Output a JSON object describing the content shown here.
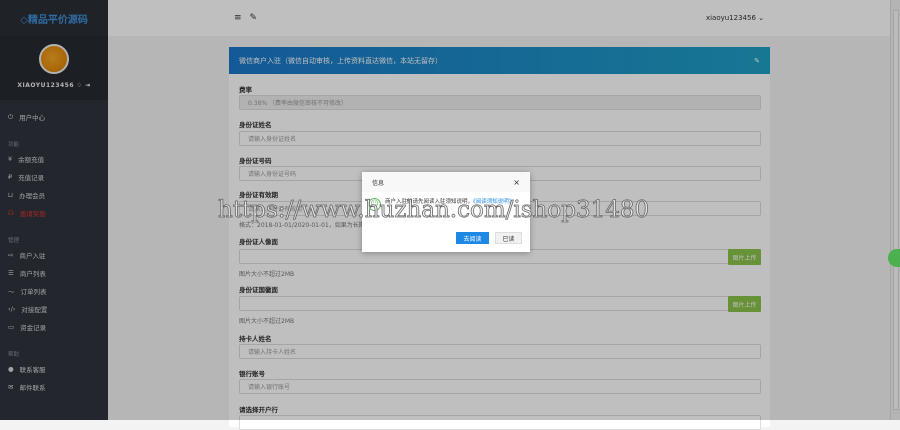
{
  "sidebar": {
    "logo": "◇精品平价源码",
    "username": "XIAOYU123456",
    "user_center": "用户中心",
    "groups": [
      {
        "title": "功能",
        "items": [
          "余额充值",
          "充值记录",
          "办理会员",
          "邀请奖励"
        ]
      },
      {
        "title": "管理",
        "items": [
          "商户入驻",
          "商户列表",
          "订单列表",
          "对接配置",
          "资金记录"
        ]
      },
      {
        "title": "帮助",
        "items": [
          "联系客服",
          "邮件联系"
        ]
      }
    ]
  },
  "topbar": {
    "menu_icon": "≡",
    "tool_icon": "✎",
    "user": "xiaoyu123456 ⌄"
  },
  "panel": {
    "title": "微信商户入驻（微信自动审核，上传资料直达微信，本站无留存）",
    "fields": [
      {
        "label": "费率",
        "value": "0.38%  （费率由微信审核不可修改）"
      },
      {
        "label": "身份证姓名",
        "placeholder": "请输入身份证姓名"
      },
      {
        "label": "身份证号码",
        "placeholder": "请输入身份证号码"
      },
      {
        "label": "身份证有效期",
        "placeholder": "请输入身份证有效期",
        "hint": "格式：2018-01-01/2020-01-01，如果为长期"
      },
      {
        "label": "身份证人像面",
        "button": "图片上传",
        "hint": "图片大小不超过2MB"
      },
      {
        "label": "身份证国徽面",
        "button": "图片上传",
        "hint": "图片大小不超过2MB"
      },
      {
        "label": "持卡人姓名",
        "placeholder": "请输入持卡人姓名"
      },
      {
        "label": "银行账号",
        "placeholder": "请输入银行账号"
      },
      {
        "label": "请选择开户行"
      }
    ]
  },
  "modal": {
    "title": "信息",
    "close": "×",
    "text": "商户入驻前请先阅读入驻须知说明，",
    "link": "《阅读须知说明》",
    "ok": "去阅读",
    "cancel": "已读"
  },
  "watermark": "https://www.huzhan.com/ishop31480"
}
